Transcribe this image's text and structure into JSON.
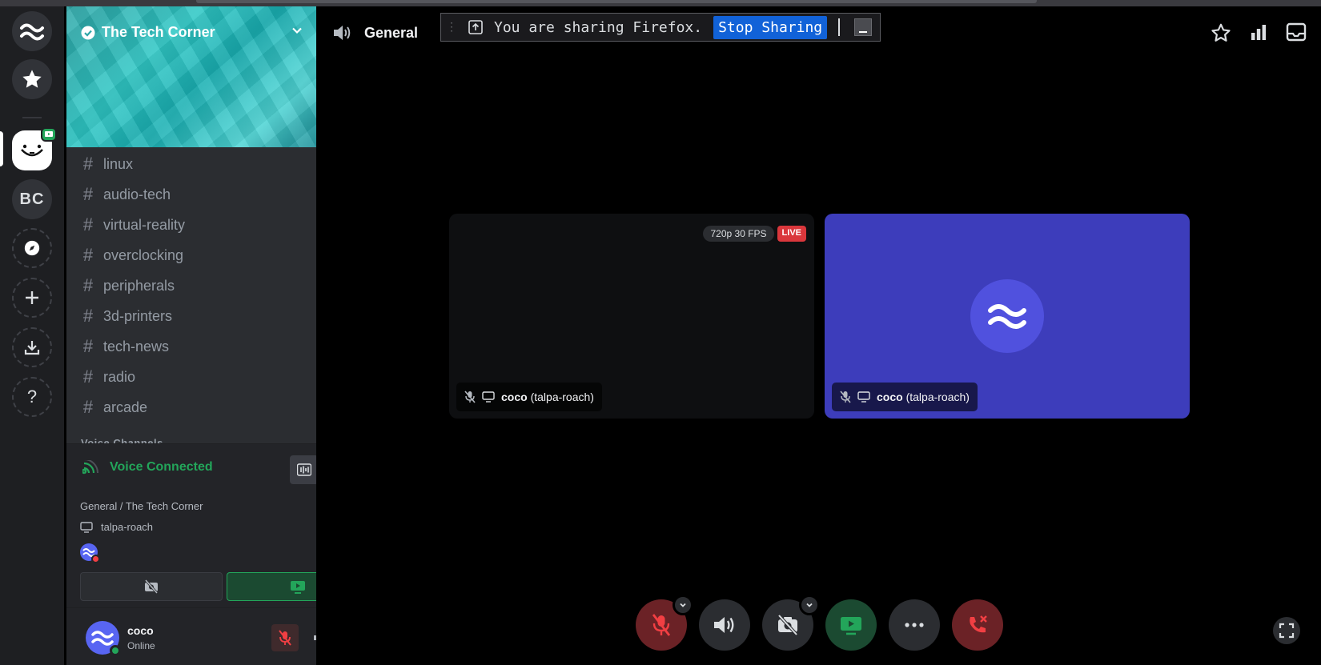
{
  "server": {
    "name": "The Tech Corner",
    "rail": {
      "initials": "BC"
    }
  },
  "channels": [
    "linux",
    "audio-tech",
    "virtual-reality",
    "overclocking",
    "peripherals",
    "3d-printers",
    "tech-news",
    "radio",
    "arcade"
  ],
  "channel_section_cutoff": "Voice Channels",
  "voice_panel": {
    "status": "Voice Connected",
    "route": "General / The Tech Corner",
    "stream_user": "talpa-roach"
  },
  "user_panel": {
    "name": "coco",
    "status": "Online"
  },
  "header": {
    "channel": "General"
  },
  "share_bar": {
    "message": "You are sharing Firefox.",
    "stop_label": "Stop Sharing"
  },
  "tiles": [
    {
      "quality": "720p 30 FPS",
      "live": "LIVE",
      "name": "coco",
      "handle": "(talpa-roach)"
    },
    {
      "name": "coco",
      "handle": "(talpa-roach)"
    }
  ],
  "colors": {
    "accent": "#5865f2",
    "voice_green": "#23a55a",
    "danger": "#da373c",
    "tile_purple": "#3d3dbb"
  }
}
